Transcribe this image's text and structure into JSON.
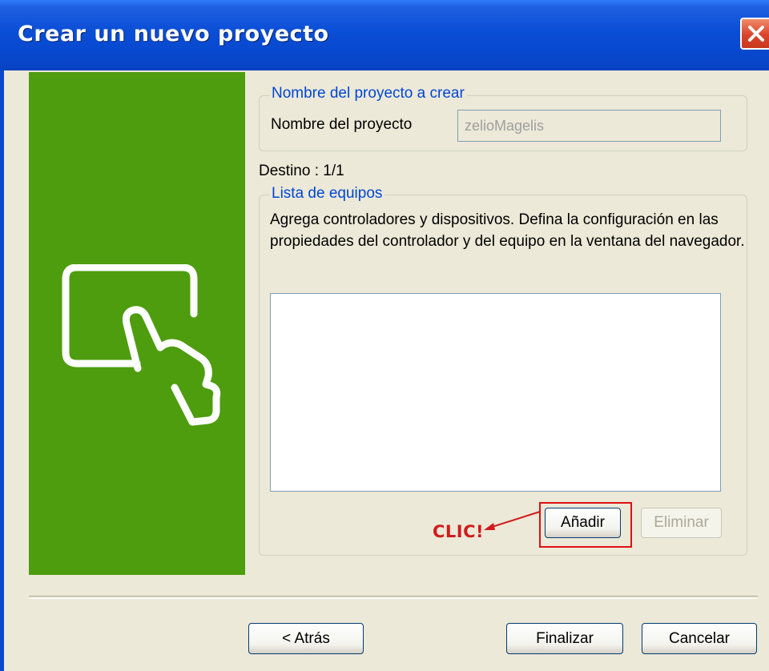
{
  "window": {
    "title": "Crear un nuevo proyecto"
  },
  "project_name_group": {
    "legend": "Nombre del proyecto a crear",
    "label": "Nombre del proyecto",
    "value": "zelioMagelis"
  },
  "destination": "Destino : 1/1",
  "equipment_group": {
    "legend": "Lista de equipos",
    "description": "Agrega controladores y dispositivos. Defina la configuración en las propiedades del controlador y del equipo en la ventana del navegador.",
    "items": [],
    "add_label": "Añadir",
    "remove_label": "Eliminar"
  },
  "annotation": {
    "text": "CLIC!",
    "color": "#d01c1c"
  },
  "footer": {
    "back_label": "< Atrás",
    "finish_label": "Finalizar",
    "cancel_label": "Cancelar"
  },
  "colors": {
    "titlebar": "#0a4ed6",
    "side_panel": "#4d9d0f",
    "legend_text": "#0046d5"
  },
  "icons": {
    "close": "close-icon",
    "side": "touch-screen-hand-icon"
  }
}
